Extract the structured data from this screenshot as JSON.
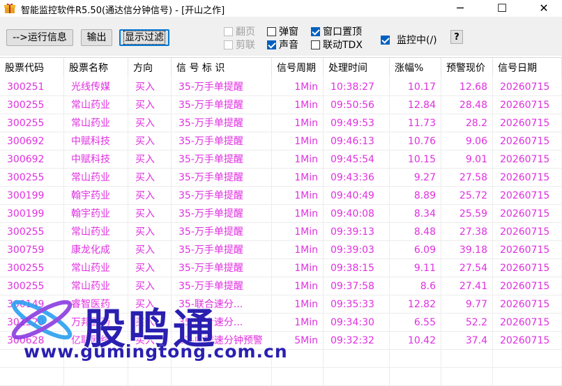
{
  "window": {
    "title": "智能监控软件R5.50(通达信分钟信号) - [开山之作]",
    "minimize": "─",
    "maximize": "☐",
    "close": "✕"
  },
  "toolbar": {
    "run_info": "-->运行信息",
    "output": "输出",
    "show_filter": "显示过滤",
    "flip": "翻页",
    "clip": "剪联",
    "popup": "弹窗",
    "sound": "声音",
    "pin_top": "窗口置顶",
    "link_tdx": "联动TDX",
    "monitoring": "监控中(/)",
    "help": "?",
    "checked": {
      "flip": false,
      "clip": false,
      "popup": false,
      "sound": true,
      "pin_top": true,
      "link_tdx": false,
      "monitoring": true
    }
  },
  "table": {
    "headers": [
      "股票代码",
      "股票名称",
      "方向",
      "信 号 标 识",
      "信号周期",
      "处理时间",
      "涨幅%",
      "预警现价",
      "信号日期"
    ],
    "rows": [
      [
        "300251",
        "光线传媒",
        "买入",
        "35-万手单提醒",
        "1Min",
        "10:38:27",
        "10.17",
        "12.68",
        "20260715"
      ],
      [
        "300255",
        "常山药业",
        "买入",
        "35-万手单提醒",
        "1Min",
        "09:50:56",
        "12.84",
        "28.48",
        "20260715"
      ],
      [
        "300255",
        "常山药业",
        "买入",
        "35-万手单提醒",
        "1Min",
        "09:49:53",
        "11.73",
        "28.2",
        "20260715"
      ],
      [
        "300692",
        "中赋科技",
        "买入",
        "35-万手单提醒",
        "1Min",
        "09:46:13",
        "10.76",
        "9.06",
        "20260715"
      ],
      [
        "300692",
        "中赋科技",
        "买入",
        "35-万手单提醒",
        "1Min",
        "09:45:54",
        "10.15",
        "9.01",
        "20260715"
      ],
      [
        "300255",
        "常山药业",
        "买入",
        "35-万手单提醒",
        "1Min",
        "09:43:36",
        "9.27",
        "27.58",
        "20260715"
      ],
      [
        "300199",
        "翰宇药业",
        "买入",
        "35-万手单提醒",
        "1Min",
        "09:40:49",
        "8.89",
        "25.72",
        "20260715"
      ],
      [
        "300199",
        "翰宇药业",
        "买入",
        "35-万手单提醒",
        "1Min",
        "09:40:08",
        "8.34",
        "25.59",
        "20260715"
      ],
      [
        "300255",
        "常山药业",
        "买入",
        "35-万手单提醒",
        "1Min",
        "09:39:13",
        "8.48",
        "27.38",
        "20260715"
      ],
      [
        "300759",
        "康龙化成",
        "买入",
        "35-万手单提醒",
        "1Min",
        "09:39:03",
        "6.09",
        "39.18",
        "20260715"
      ],
      [
        "300255",
        "常山药业",
        "买入",
        "35-万手单提醒",
        "1Min",
        "09:38:15",
        "9.11",
        "27.54",
        "20260715"
      ],
      [
        "300255",
        "常山药业",
        "买入",
        "35-万手单提醒",
        "1Min",
        "09:37:58",
        "8.6",
        "27.41",
        "20260715"
      ],
      [
        "300149",
        "睿智医药",
        "买入",
        "35-联合速分...",
        "1Min",
        "09:35:33",
        "12.82",
        "9.77",
        "20260715"
      ],
      [
        "301520",
        "万邦医药",
        "买入",
        "35-联合速分...",
        "1Min",
        "09:34:30",
        "6.55",
        "52.2",
        "20260715"
      ],
      [
        "300628",
        "亿联网络",
        "买入",
        "12-中程速分钟预警",
        "5Min",
        "09:32:32",
        "10.42",
        "37.4",
        "20260715"
      ]
    ]
  },
  "watermark": {
    "name": "股鸣通",
    "url": "www.gumingtong.com.cn"
  },
  "colors": {
    "row_text": "#e030e0",
    "watermark": "#2a1fb0",
    "accent": "#0060c0"
  }
}
